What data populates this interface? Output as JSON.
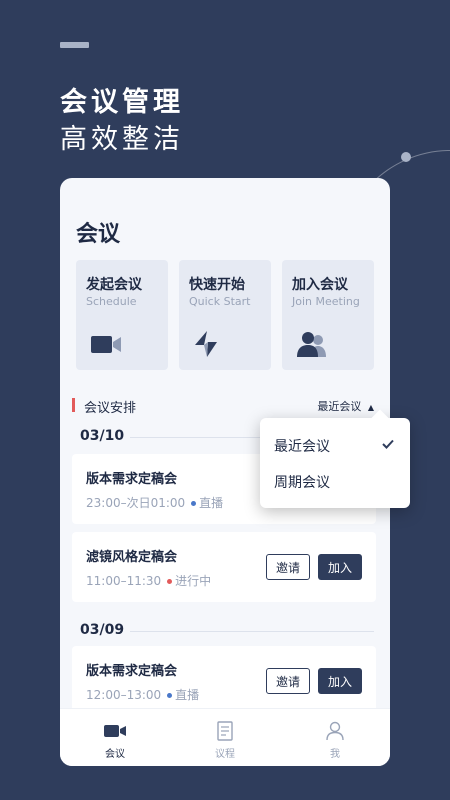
{
  "hero": {
    "title": "会议管理",
    "subtitle": "高效整洁"
  },
  "card": {
    "title": "会议",
    "quick_actions": [
      {
        "title": "发起会议",
        "subtitle": "Schedule",
        "icon": "video-camera-icon"
      },
      {
        "title": "快速开始",
        "subtitle": "Quick Start",
        "icon": "lightning-icon"
      },
      {
        "title": "加入会议",
        "subtitle": "Join Meeting",
        "icon": "users-icon"
      }
    ],
    "section_title": "会议安排",
    "sort_label": "最近会议",
    "groups": [
      {
        "date": "03/10",
        "meetings": [
          {
            "title": "版本需求定稿会",
            "time": "23:00–次日01:00",
            "status": "直播",
            "status_color": "#4a78c9"
          },
          {
            "title": "滤镜风格定稿会",
            "time": "11:00–11:30",
            "status": "进行中",
            "status_color": "#e25a5a",
            "invite": "邀请",
            "join": "加入"
          }
        ]
      },
      {
        "date": "03/09",
        "meetings": [
          {
            "title": "版本需求定稿会",
            "time": "12:00–13:00",
            "status": "直播",
            "status_color": "#4a78c9",
            "invite": "邀请",
            "join": "加入"
          }
        ]
      }
    ]
  },
  "dropdown": {
    "options": [
      {
        "label": "最近会议",
        "selected": true
      },
      {
        "label": "周期会议",
        "selected": false
      }
    ]
  },
  "tabbar": {
    "tabs": [
      {
        "label": "会议",
        "icon": "video-camera-icon",
        "active": true
      },
      {
        "label": "议程",
        "icon": "document-icon",
        "active": false
      },
      {
        "label": "我",
        "icon": "user-icon",
        "active": false
      }
    ]
  },
  "colors": {
    "background": "#2f3d5c",
    "accent_red": "#e25a5a",
    "live_blue": "#4a78c9"
  }
}
